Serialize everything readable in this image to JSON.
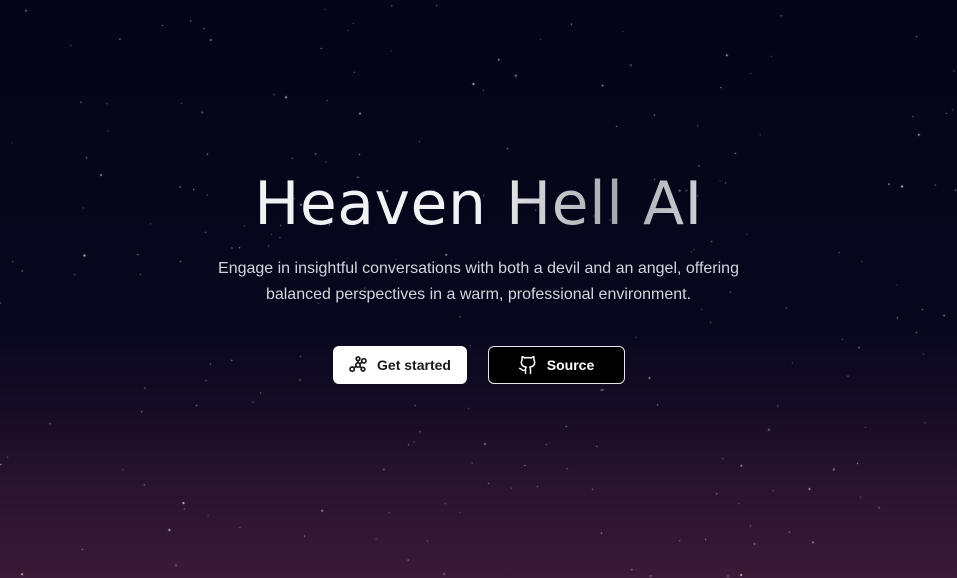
{
  "hero": {
    "title": "Heaven Hell AI",
    "subtitle": "Engage in insightful conversations with both a devil and an angel, offering balanced perspectives in a warm, professional environment."
  },
  "actions": {
    "primary_label": "Get started",
    "primary_icon": "workflow-icon",
    "secondary_label": "Source",
    "secondary_icon": "github-icon"
  },
  "colors": {
    "background_top": "#05051a",
    "background_bottom": "#3a1a36",
    "primary_button_bg": "#ffffff",
    "secondary_button_bg": "#000000"
  }
}
